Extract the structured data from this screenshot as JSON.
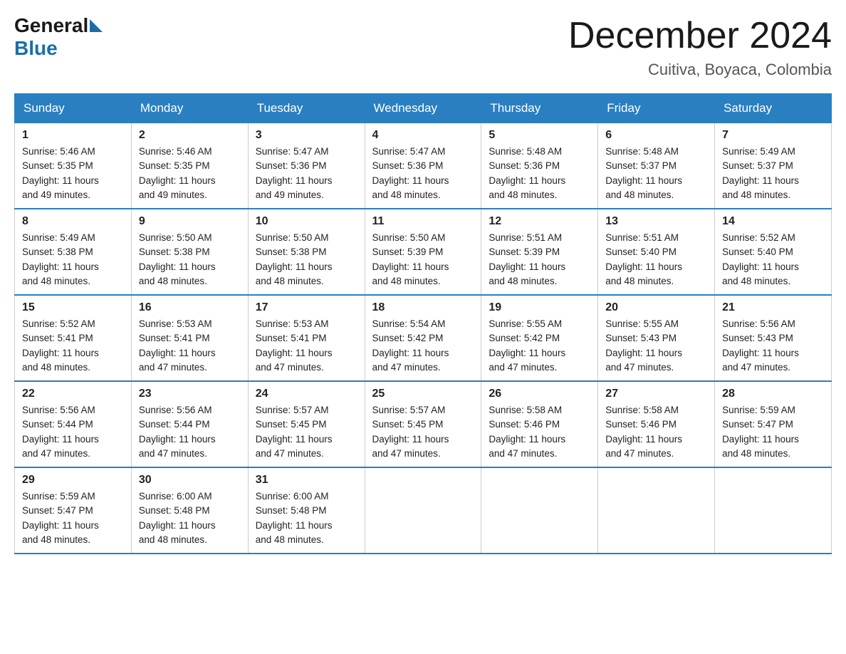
{
  "logo": {
    "general": "General",
    "blue": "Blue"
  },
  "title": {
    "month": "December 2024",
    "location": "Cuitiva, Boyaca, Colombia"
  },
  "headers": [
    "Sunday",
    "Monday",
    "Tuesday",
    "Wednesday",
    "Thursday",
    "Friday",
    "Saturday"
  ],
  "weeks": [
    [
      {
        "day": "1",
        "sunrise": "5:46 AM",
        "sunset": "5:35 PM",
        "daylight": "11 hours and 49 minutes."
      },
      {
        "day": "2",
        "sunrise": "5:46 AM",
        "sunset": "5:35 PM",
        "daylight": "11 hours and 49 minutes."
      },
      {
        "day": "3",
        "sunrise": "5:47 AM",
        "sunset": "5:36 PM",
        "daylight": "11 hours and 49 minutes."
      },
      {
        "day": "4",
        "sunrise": "5:47 AM",
        "sunset": "5:36 PM",
        "daylight": "11 hours and 48 minutes."
      },
      {
        "day": "5",
        "sunrise": "5:48 AM",
        "sunset": "5:36 PM",
        "daylight": "11 hours and 48 minutes."
      },
      {
        "day": "6",
        "sunrise": "5:48 AM",
        "sunset": "5:37 PM",
        "daylight": "11 hours and 48 minutes."
      },
      {
        "day": "7",
        "sunrise": "5:49 AM",
        "sunset": "5:37 PM",
        "daylight": "11 hours and 48 minutes."
      }
    ],
    [
      {
        "day": "8",
        "sunrise": "5:49 AM",
        "sunset": "5:38 PM",
        "daylight": "11 hours and 48 minutes."
      },
      {
        "day": "9",
        "sunrise": "5:50 AM",
        "sunset": "5:38 PM",
        "daylight": "11 hours and 48 minutes."
      },
      {
        "day": "10",
        "sunrise": "5:50 AM",
        "sunset": "5:38 PM",
        "daylight": "11 hours and 48 minutes."
      },
      {
        "day": "11",
        "sunrise": "5:50 AM",
        "sunset": "5:39 PM",
        "daylight": "11 hours and 48 minutes."
      },
      {
        "day": "12",
        "sunrise": "5:51 AM",
        "sunset": "5:39 PM",
        "daylight": "11 hours and 48 minutes."
      },
      {
        "day": "13",
        "sunrise": "5:51 AM",
        "sunset": "5:40 PM",
        "daylight": "11 hours and 48 minutes."
      },
      {
        "day": "14",
        "sunrise": "5:52 AM",
        "sunset": "5:40 PM",
        "daylight": "11 hours and 48 minutes."
      }
    ],
    [
      {
        "day": "15",
        "sunrise": "5:52 AM",
        "sunset": "5:41 PM",
        "daylight": "11 hours and 48 minutes."
      },
      {
        "day": "16",
        "sunrise": "5:53 AM",
        "sunset": "5:41 PM",
        "daylight": "11 hours and 47 minutes."
      },
      {
        "day": "17",
        "sunrise": "5:53 AM",
        "sunset": "5:41 PM",
        "daylight": "11 hours and 47 minutes."
      },
      {
        "day": "18",
        "sunrise": "5:54 AM",
        "sunset": "5:42 PM",
        "daylight": "11 hours and 47 minutes."
      },
      {
        "day": "19",
        "sunrise": "5:55 AM",
        "sunset": "5:42 PM",
        "daylight": "11 hours and 47 minutes."
      },
      {
        "day": "20",
        "sunrise": "5:55 AM",
        "sunset": "5:43 PM",
        "daylight": "11 hours and 47 minutes."
      },
      {
        "day": "21",
        "sunrise": "5:56 AM",
        "sunset": "5:43 PM",
        "daylight": "11 hours and 47 minutes."
      }
    ],
    [
      {
        "day": "22",
        "sunrise": "5:56 AM",
        "sunset": "5:44 PM",
        "daylight": "11 hours and 47 minutes."
      },
      {
        "day": "23",
        "sunrise": "5:56 AM",
        "sunset": "5:44 PM",
        "daylight": "11 hours and 47 minutes."
      },
      {
        "day": "24",
        "sunrise": "5:57 AM",
        "sunset": "5:45 PM",
        "daylight": "11 hours and 47 minutes."
      },
      {
        "day": "25",
        "sunrise": "5:57 AM",
        "sunset": "5:45 PM",
        "daylight": "11 hours and 47 minutes."
      },
      {
        "day": "26",
        "sunrise": "5:58 AM",
        "sunset": "5:46 PM",
        "daylight": "11 hours and 47 minutes."
      },
      {
        "day": "27",
        "sunrise": "5:58 AM",
        "sunset": "5:46 PM",
        "daylight": "11 hours and 47 minutes."
      },
      {
        "day": "28",
        "sunrise": "5:59 AM",
        "sunset": "5:47 PM",
        "daylight": "11 hours and 48 minutes."
      }
    ],
    [
      {
        "day": "29",
        "sunrise": "5:59 AM",
        "sunset": "5:47 PM",
        "daylight": "11 hours and 48 minutes."
      },
      {
        "day": "30",
        "sunrise": "6:00 AM",
        "sunset": "5:48 PM",
        "daylight": "11 hours and 48 minutes."
      },
      {
        "day": "31",
        "sunrise": "6:00 AM",
        "sunset": "5:48 PM",
        "daylight": "11 hours and 48 minutes."
      },
      null,
      null,
      null,
      null
    ]
  ],
  "labels": {
    "sunrise": "Sunrise:",
    "sunset": "Sunset:",
    "daylight": "Daylight:"
  }
}
